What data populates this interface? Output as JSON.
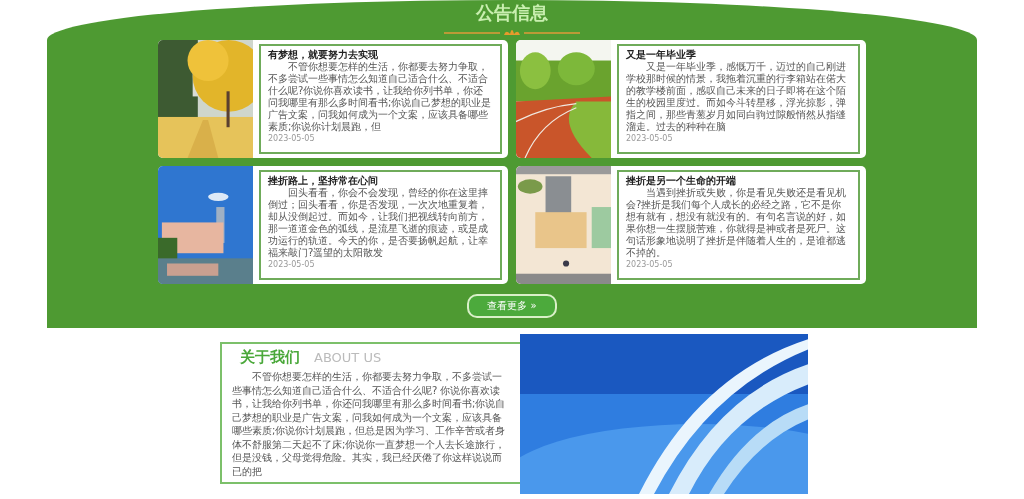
{
  "notices": {
    "title": "公告信息",
    "cards": [
      {
        "kind": "ginkgo",
        "title": "有梦想，就要努力去实现",
        "body": "不管你想要怎样的生活，你都要去努力争取，不多尝试一些事情怎么知道自己适合什么、不适合什么呢?你说你喜欢读书，让我给你列书单，你还问我哪里有那么多时间看书;你说自己梦想的职业是广告文案，问我如何成为一个文案，应该具备哪些素质;你说你计划晨跑，但",
        "date": "2023-05-05"
      },
      {
        "kind": "track",
        "title": "又是一年毕业季",
        "body": "又是一年毕业季，感慨万千，迈过的自己刚进学校那时候的情景，我拖着沉重的行李箱站在偌大的教学楼前面，感叹自己未来的日子即将在这个陌生的校园里度过。而如今斗转星移，浮光掠影，弹指之间，那些青葱岁月如同白驹过隙般悄然从指缝溜走。过去的种种在脑",
        "date": "2023-05-05"
      },
      {
        "kind": "campus",
        "title": "挫折路上，坚持常在心间",
        "body": "回头看看，你会不会发现，曾经的你在这里摔倒过；回头看看，你是否发现，一次次地重复着，却从没倒起过。而如今，让我们把视线转向前方，那一道道金色的弧线，是流星飞逝的痕迹，或是成功运行的轨道。今天的你，是否要扬帆起航，让幸福来敲门?遥望的太阳散发",
        "date": "2023-05-05"
      },
      {
        "kind": "illustration",
        "title": "挫折是另一个生命的开端",
        "body": "当遇到挫折或失败，你是看见失败还是看见机会?挫折是我们每个人成长的必经之路，它不是你想有就有，想没有就没有的。有句名言说的好，如果你想一生摆脱苦难，你就得是神或者是死尸。这句话形象地说明了挫折是伴随着人生的，是谁都逃不掉的。",
        "date": "2023-05-05"
      }
    ],
    "more_button": "查看更多 »"
  },
  "about": {
    "title": "关于我们",
    "subtitle": "ABOUT US",
    "body": "不管你想要怎样的生活，你都要去努力争取，不多尝试一些事情怎么知道自己适合什么、不适合什么呢? 你说你喜欢读书，让我给你列书单，你还问我哪里有那么多时间看书;你说自己梦想的职业是广告文案，问我如何成为一个文案，应该具备哪些素质;你说你计划晨跑，但总是因为学习、工作辛苦或者身体不舒服第二天起不了床;你说你一直梦想一个人去长途旅行，但是没钱，父母觉得危险。其实，我已经厌倦了你这样说说而已的把"
  }
}
